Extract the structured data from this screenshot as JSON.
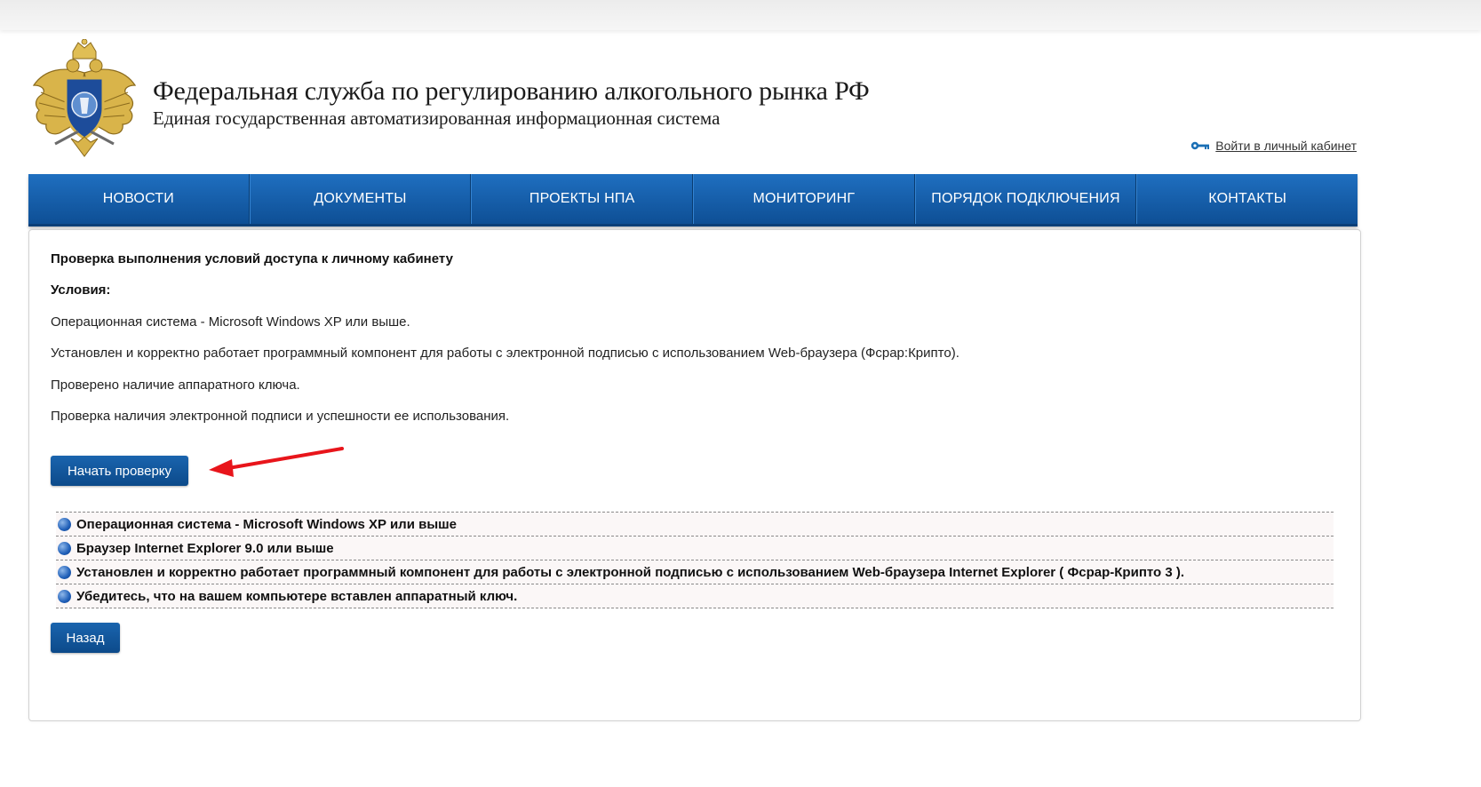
{
  "header": {
    "org_title": "Федеральная служба по регулированию алкогольного рынка РФ",
    "org_subtitle": "Единая государственная автоматизированная информационная система",
    "login_link": "Войти в личный кабинет",
    "emblem_icon": "coat-of-arms-emblem",
    "login_icon": "key-icon"
  },
  "nav": {
    "items": [
      {
        "label": "НОВОСТИ"
      },
      {
        "label": "ДОКУМЕНТЫ"
      },
      {
        "label": "ПРОЕКТЫ НПА"
      },
      {
        "label": "МОНИТОРИНГ"
      },
      {
        "label": "ПОРЯДОК ПОДКЛЮЧЕНИЯ"
      },
      {
        "label": "КОНТАКТЫ"
      }
    ]
  },
  "main": {
    "title": "Проверка выполнения условий доступа к личному кабинету",
    "conditions_label": "Условия:",
    "conditions": [
      "Операционная система - Microsoft Windows XP или выше.",
      "Установлен и корректно работает программный компонент для работы с электронной подписью с использованием Web-браузера (Фсрар:Крипто).",
      "Проверено наличие аппаратного ключа.",
      "Проверка наличия электронной подписи и успешности ее использования."
    ],
    "start_button": "Начать проверку",
    "checklist": [
      "Операционная система - Microsoft Windows XP или выше",
      "Браузер Internet Explorer 9.0 или выше",
      "Установлен и корректно работает программный компонент для работы с электронной подписью с использованием Web-браузера Internet Explorer ( Фсрар-Крипто 3 ).",
      "Убедитесь, что на вашем компьютере вставлен аппаратный ключ."
    ],
    "back_button": "Назад"
  },
  "colors": {
    "nav_blue": "#1366b5",
    "button_blue": "#0f55a0",
    "annotation_arrow": "#e8151b",
    "status_dot": "#1f5fb8"
  }
}
